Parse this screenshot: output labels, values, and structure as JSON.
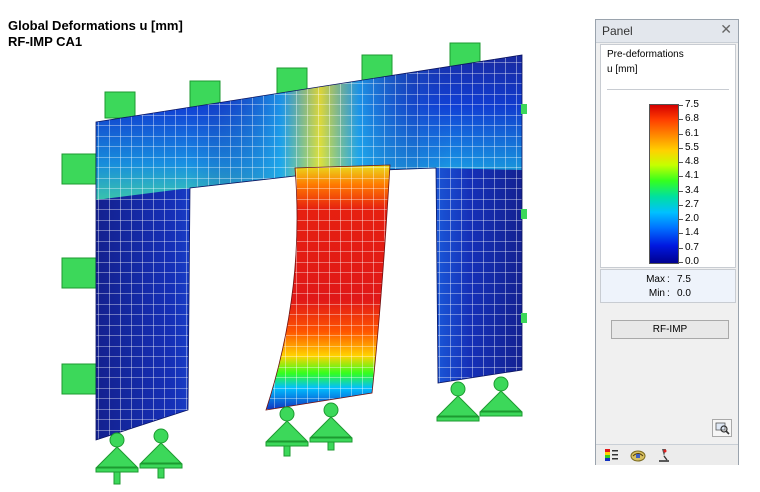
{
  "viewport": {
    "title_line1": "Global Deformations u [mm]",
    "title_line2": "RF-IMP CA1"
  },
  "panel": {
    "title": "Panel",
    "close_glyph": "✕",
    "caption": "Pre-deformations",
    "unit": "u [mm]",
    "legend": {
      "values": [
        "7.5",
        "6.8",
        "6.1",
        "5.5",
        "4.8",
        "4.1",
        "3.4",
        "2.7",
        "2.0",
        "1.4",
        "0.7",
        "0.0"
      ],
      "colors": {
        "max": "#d40000",
        "mid": "#34ff1e",
        "min": "#000090"
      }
    },
    "max_label": "Max",
    "max_value": "7.5",
    "min_label": "Min",
    "min_value": "0.0",
    "button_label": "RF-IMP",
    "footer_icons": [
      "color-scale-icon",
      "results-icon",
      "microscope-icon"
    ]
  },
  "colors": {
    "mesh_low": "#1a2aa0",
    "mesh_high": "#e01818",
    "support": "#3cd85a",
    "mesh_grid": "#ffffff"
  }
}
